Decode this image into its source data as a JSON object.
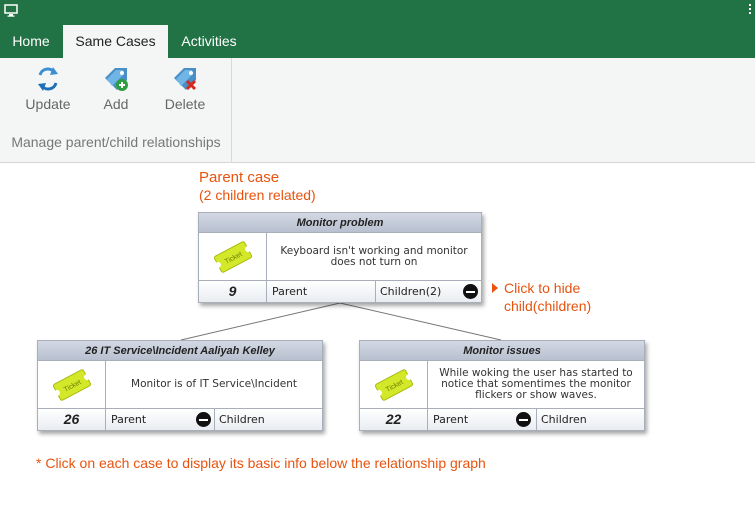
{
  "tabs": [
    {
      "label": "Home"
    },
    {
      "label": "Same Cases"
    },
    {
      "label": "Activities"
    }
  ],
  "ribbon": {
    "update_label": "Update",
    "add_label": "Add",
    "delete_label": "Delete",
    "group_label": "Manage parent/child relationships"
  },
  "annotations": {
    "parent_title": "Parent case",
    "parent_sub": "(2 children related)",
    "hide_line1": "Click to hide",
    "hide_line2": "child(children)",
    "footnote": "* Click on each case to display its basic info below the relationship graph"
  },
  "parent_case": {
    "title": "Monitor problem",
    "description": "Keyboard isn't working and monitor does not turn on",
    "number": "9",
    "parent_label": "Parent",
    "children_label": "Children(2)",
    "ticket_text": "Ticket"
  },
  "child_cases": [
    {
      "title": "26 IT Service\\Incident Aaliyah Kelley",
      "description": "Monitor is of IT Service\\Incident",
      "number": "26",
      "parent_label": "Parent",
      "children_label": "Children",
      "ticket_text": "Ticket"
    },
    {
      "title": "Monitor issues",
      "description": "While woking the user has started to notice that somentimes the monitor flickers or show waves.",
      "number": "22",
      "parent_label": "Parent",
      "children_label": "Children",
      "ticket_text": "Ticket"
    }
  ],
  "colors": {
    "brand_green": "#217346",
    "annotation_orange": "#e8530e",
    "ticket_yellow": "#d4e82a"
  },
  "icons": {
    "app": "monitor-icon",
    "update": "refresh-icon",
    "add": "add-tag-icon",
    "delete": "delete-tag-icon",
    "ticket": "ticket-icon",
    "toggle": "minus-circle-icon"
  }
}
